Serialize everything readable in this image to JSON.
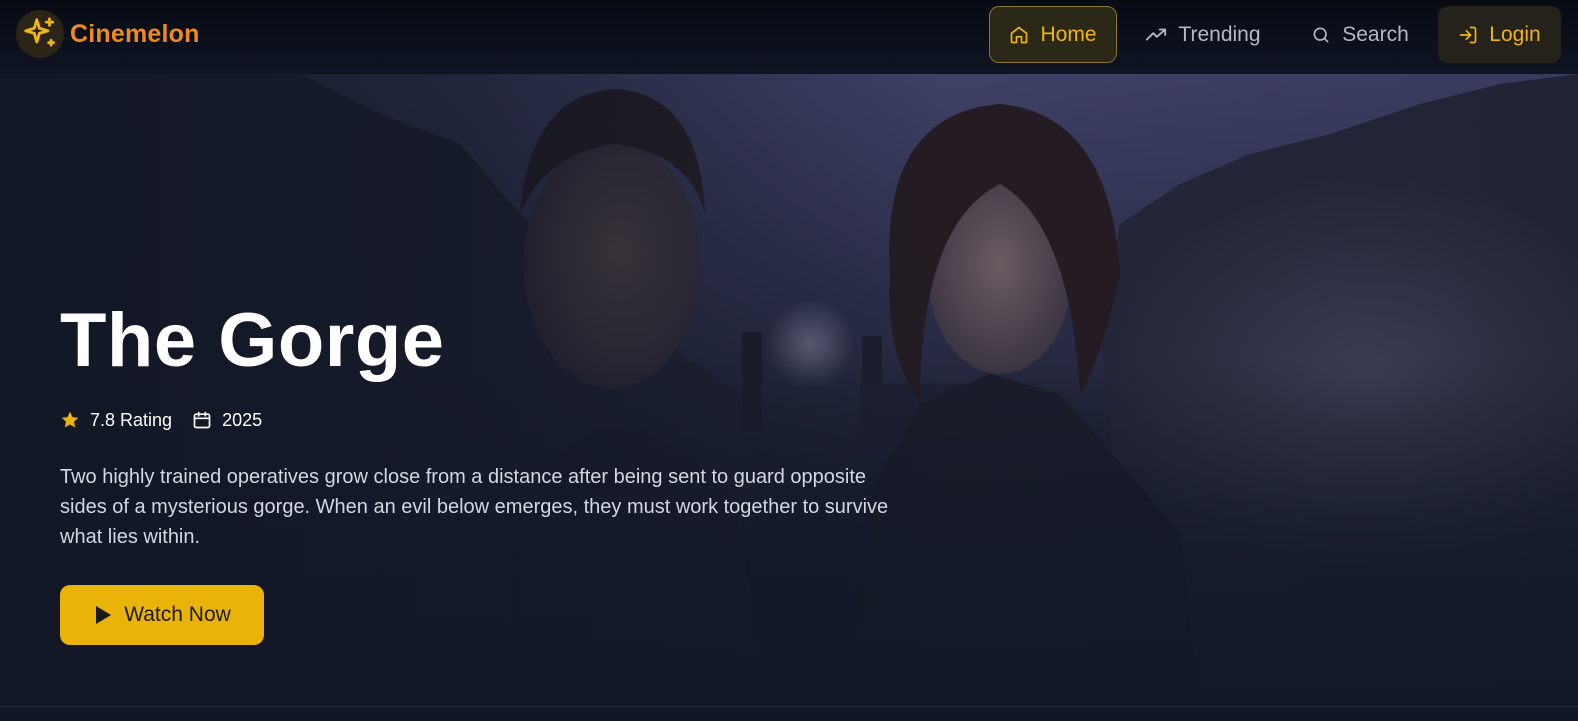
{
  "brand": {
    "name": "Cinemelon",
    "logo_icon": "sparkles-icon"
  },
  "nav": {
    "items": [
      {
        "label": "Home",
        "icon": "home-icon",
        "active": true
      },
      {
        "label": "Trending",
        "icon": "trending-up-icon",
        "active": false
      },
      {
        "label": "Search",
        "icon": "search-icon",
        "active": false
      }
    ],
    "login": {
      "label": "Login",
      "icon": "log-in-icon"
    }
  },
  "hero": {
    "title": "The Gorge",
    "rating": "7.8 Rating",
    "year": "2025",
    "description": "Two highly trained operatives grow close from a distance after being sent to guard opposite sides of a mysterious gorge. When an evil below emerges, they must work together to survive what lies within.",
    "cta": {
      "label": "Watch Now",
      "icon": "play-icon"
    }
  },
  "colors": {
    "accent": "#eab308",
    "brand": "#f08a1c",
    "background": "#121826"
  }
}
